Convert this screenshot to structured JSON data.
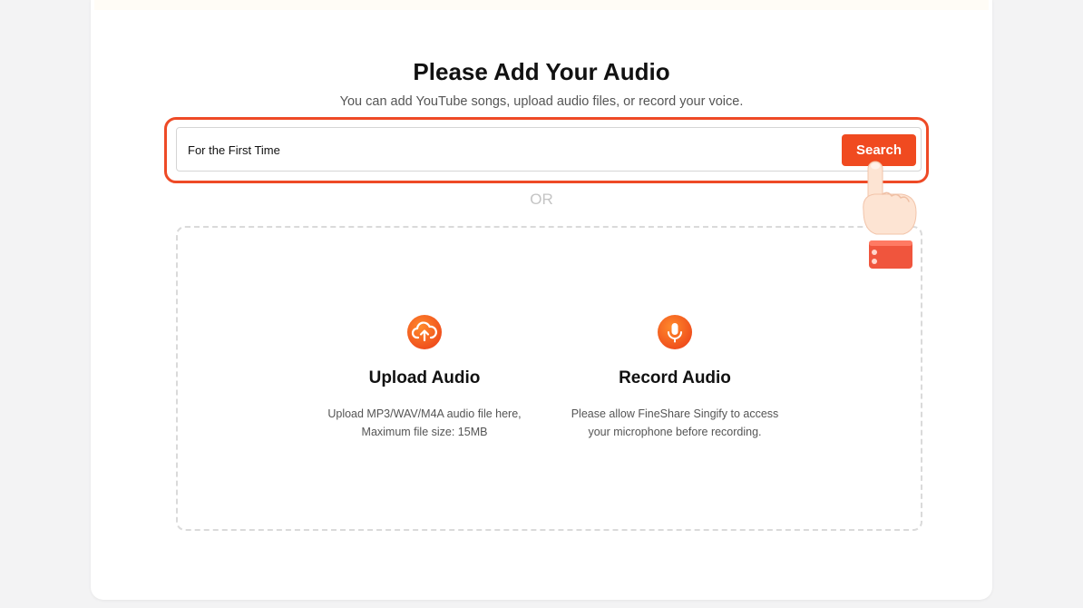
{
  "header": {
    "title": "Please Add Your Audio",
    "subtitle": "You can add YouTube songs, upload audio files, or record your voice."
  },
  "search": {
    "value": "For the First Time",
    "button_label": "Search"
  },
  "divider": {
    "label": "OR"
  },
  "upload": {
    "icon": "cloud-upload-icon",
    "title": "Upload Audio",
    "desc_line1": "Upload MP3/WAV/M4A audio file here,",
    "desc_line2": "Maximum file size: 15MB"
  },
  "record": {
    "icon": "microphone-icon",
    "title": "Record Audio",
    "desc_line1": "Please allow FineShare Singify to access",
    "desc_line2": "your microphone before recording."
  },
  "colors": {
    "accent": "#f04a20",
    "highlight_border": "#ee4a26",
    "background": "#f3f3f4"
  }
}
